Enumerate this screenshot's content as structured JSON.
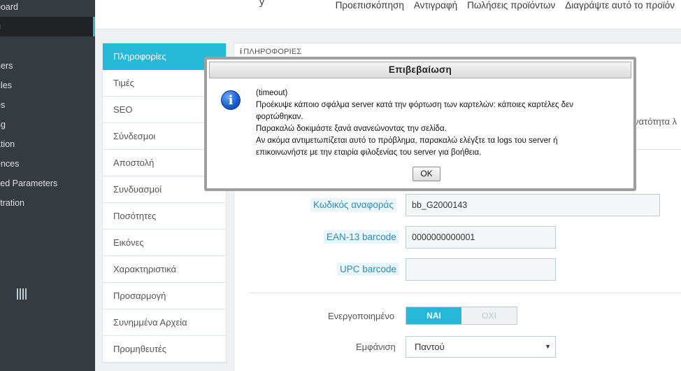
{
  "sidebar": {
    "items": [
      {
        "label": "board",
        "active": false
      },
      {
        "label": "g",
        "active": true
      },
      {
        "label": "ners",
        "active": false
      },
      {
        "label": "ules",
        "active": false
      },
      {
        "label": "es",
        "active": false
      },
      {
        "label": "ng",
        "active": false
      },
      {
        "label": "ation",
        "active": false
      },
      {
        "label": "ences",
        "active": false
      },
      {
        "label": "ced Parameters",
        "active": false
      },
      {
        "label": "stration",
        "active": false
      }
    ],
    "collapse_icon": "barcode-icon"
  },
  "header": {
    "title_fragment": "y",
    "links": [
      "Προεπισκόπηση",
      "Αντιγραφή",
      "Πωλήσεις προϊόντων",
      "Διαγράψτε αυτό το προϊόν"
    ]
  },
  "tabs": [
    {
      "label": "Πληροφορίες",
      "active": true
    },
    {
      "label": "Τιμές"
    },
    {
      "label": "SEO"
    },
    {
      "label": "Σύνδεσμοι"
    },
    {
      "label": "Αποστολή"
    },
    {
      "label": "Συνδυασμοί"
    },
    {
      "label": "Ποσότητες"
    },
    {
      "label": "Εικόνες"
    },
    {
      "label": "Χαρακτηριστικά"
    },
    {
      "label": "Προσαρμογή"
    },
    {
      "label": "Συνημμένα Αρχεία"
    },
    {
      "label": "Προμηθευτές"
    }
  ],
  "panel": {
    "heading": "ΠΛΗΡΟΦΟΡΙΕΣ",
    "heading_icon": "info-icon",
    "right_text": "νατότητα λ"
  },
  "form": {
    "reference": {
      "label": "Κωδικός αναφοράς",
      "value": "bb_G2000143"
    },
    "ean13": {
      "label": "EAN-13 barcode",
      "value": "0000000000001"
    },
    "upc": {
      "label": "UPC barcode",
      "value": ""
    },
    "enabled": {
      "label": "Ενεργοποιημένο",
      "on_label": "ΝΑΙ",
      "off_label": "ΟΧΙ",
      "value": "ΝΑΙ"
    },
    "visibility": {
      "label": "Εμφάνιση",
      "value": "Παντού"
    }
  },
  "modal": {
    "title": "Επιβεβαίωση",
    "icon": "info-icon",
    "lines": [
      "(timeout)",
      "Προέκυψε κάποιο σφάλμα server κατά την φόρτωση των καρτελών: κάποιες καρτέλες δεν φορτώθηκαν.",
      "Παρακαλώ δοκιμάστε ξανά ανανεώνοντας την σελίδα.",
      "Αν ακόμα αντιμετωπίζεται αυτό το πρόβλημα, παρακαλώ ελέγξτε τα logs του server ή επικοινωνήστε με την εταιρία φιλοξενίας του server για βοήθεια."
    ],
    "ok_label": "OK"
  },
  "colors": {
    "accent": "#25b9d7",
    "sidebar_bg": "#363a41",
    "hint_text": "#2e8cb8"
  }
}
